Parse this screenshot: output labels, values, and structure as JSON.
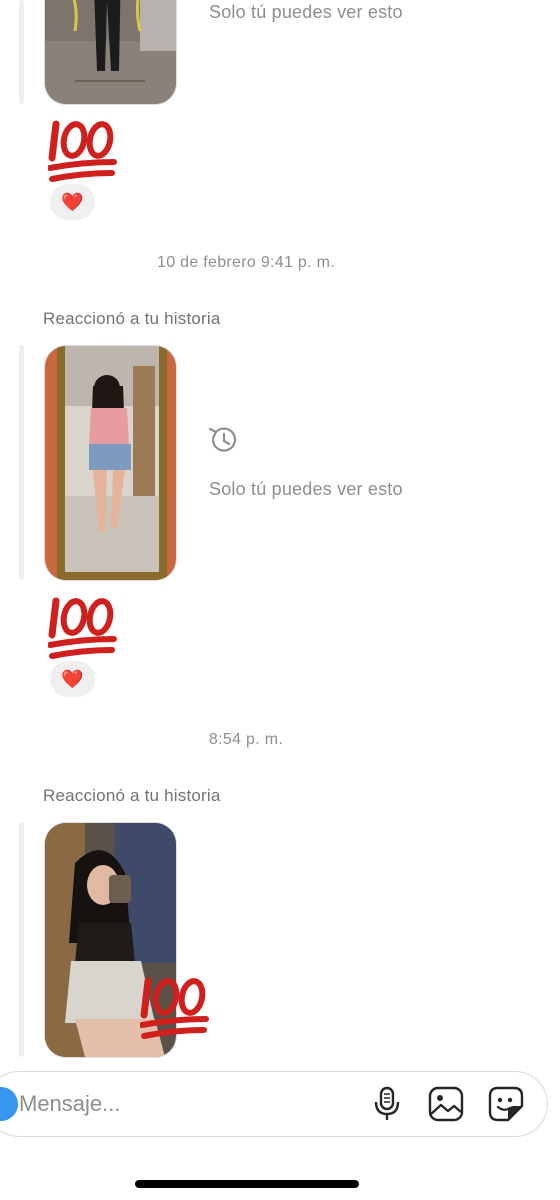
{
  "messages": [
    {
      "only_you_text": "Solo tú puedes ver esto",
      "reaction_emoji": "❤️",
      "sticker_icon": "hundred-points-emoji"
    },
    {
      "timestamp": "10 de febrero 9:41 p. m.",
      "label": "Reaccionó a tu historia",
      "only_you_text": "Solo tú puedes ver esto",
      "reaction_emoji": "❤️",
      "sticker_icon": "hundred-points-emoji"
    },
    {
      "timestamp": "8:54 p. m.",
      "label": "Reaccionó a tu historia",
      "sticker_icon": "hundred-points-emoji"
    }
  ],
  "composer": {
    "placeholder": "Mensaje...",
    "icons": [
      "camera-icon",
      "microphone-icon",
      "gallery-icon",
      "sticker-icon"
    ]
  },
  "colors": {
    "accent": "#3797f0",
    "hint_text": "#8e8e8e",
    "emoji_red": "#d0201d",
    "pill_bg": "#efefef"
  }
}
